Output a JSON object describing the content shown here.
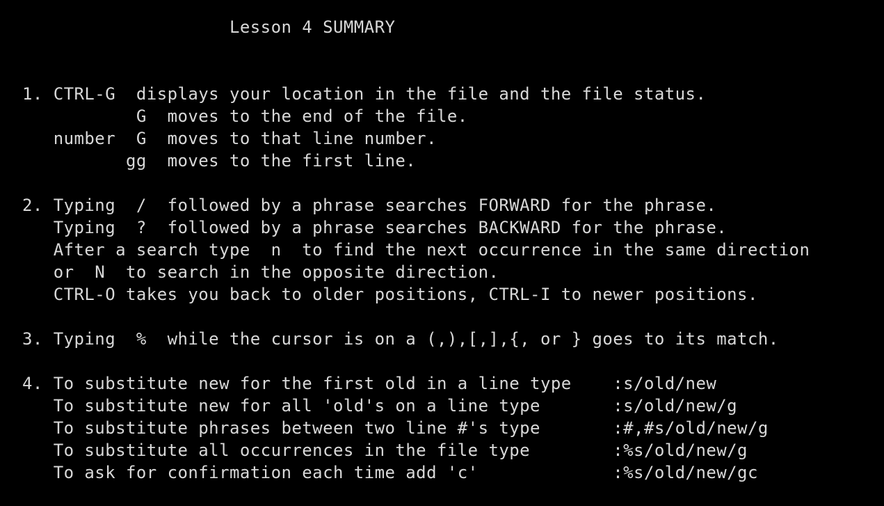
{
  "colors": {
    "background": "#000000",
    "text": "#d8d8d8"
  },
  "title": "                    Lesson 4 SUMMARY",
  "lines": [
    "1. CTRL-G  displays your location in the file and the file status.",
    "           G  moves to the end of the file.",
    "   number  G  moves to that line number.",
    "          gg  moves to the first line.",
    "2. Typing  /  followed by a phrase searches FORWARD for the phrase.",
    "   Typing  ?  followed by a phrase searches BACKWARD for the phrase.",
    "   After a search type  n  to find the next occurrence in the same direction",
    "   or  N  to search in the opposite direction.",
    "   CTRL-O takes you back to older positions, CTRL-I to newer positions.",
    "3. Typing  %  while the cursor is on a (,),[,],{, or } goes to its match.",
    "4. To substitute new for the first old in a line type    :s/old/new",
    "   To substitute new for all 'old's on a line type       :s/old/new/g",
    "   To substitute phrases between two line #'s type       :#,#s/old/new/g",
    "   To substitute all occurrences in the file type        :%s/old/new/g",
    "   To ask for confirmation each time add 'c'             :%s/old/new/gc"
  ]
}
